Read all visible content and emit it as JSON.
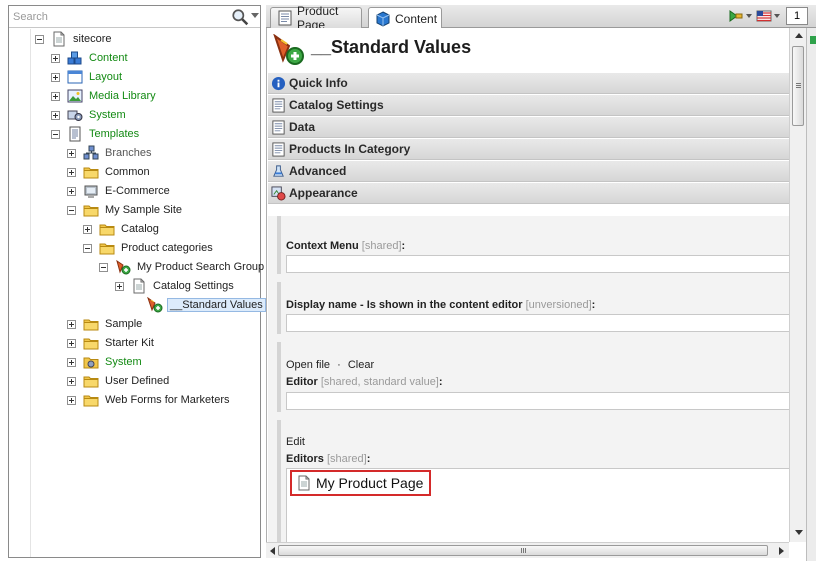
{
  "search": {
    "placeholder": "Search"
  },
  "tree": {
    "items": [
      {
        "label": "sitecore",
        "toggle": "minus",
        "color": "normal",
        "icon": "page-icon"
      },
      {
        "label": "Content",
        "toggle": "plus",
        "color": "green",
        "icon": "content-cubes-icon"
      },
      {
        "label": "Layout",
        "toggle": "plus",
        "color": "green",
        "icon": "layout-window-icon"
      },
      {
        "label": "Media Library",
        "toggle": "plus",
        "color": "green",
        "icon": "media-picture-icon"
      },
      {
        "label": "System",
        "toggle": "plus",
        "color": "green",
        "icon": "system-gear-icon"
      },
      {
        "label": "Templates",
        "toggle": "minus",
        "color": "green",
        "icon": "template-document-icon"
      },
      {
        "label": "Branches",
        "toggle": "plus",
        "color": "gray",
        "icon": "branches-icon"
      },
      {
        "label": "Common",
        "toggle": "plus",
        "color": "normal",
        "icon": "folder-icon"
      },
      {
        "label": "E-Commerce",
        "toggle": "plus",
        "color": "normal",
        "icon": "ecommerce-icon"
      },
      {
        "label": "My Sample Site",
        "toggle": "minus",
        "color": "normal",
        "icon": "folder-icon"
      },
      {
        "label": "Catalog",
        "toggle": "plus",
        "color": "normal",
        "icon": "folder-icon"
      },
      {
        "label": "Product categories",
        "toggle": "minus",
        "color": "normal",
        "icon": "folder-icon"
      },
      {
        "label": "My Product Search Group",
        "toggle": "minus",
        "color": "normal",
        "icon": "search-group-icon"
      },
      {
        "label": "Catalog Settings",
        "toggle": "plus",
        "color": "normal",
        "icon": "page-icon"
      },
      {
        "label": "__Standard Values",
        "toggle": "none",
        "color": "normal",
        "icon": "standard-values-icon",
        "selected": true
      },
      {
        "label": "Sample",
        "toggle": "plus",
        "color": "normal",
        "icon": "folder-icon"
      },
      {
        "label": "Starter Kit",
        "toggle": "plus",
        "color": "normal",
        "icon": "folder-icon"
      },
      {
        "label": "System",
        "toggle": "plus",
        "color": "green",
        "icon": "system-folder-icon"
      },
      {
        "label": "User Defined",
        "toggle": "plus",
        "color": "normal",
        "icon": "folder-icon"
      },
      {
        "label": "Web Forms for Marketers",
        "toggle": "plus",
        "color": "normal",
        "icon": "folder-icon"
      }
    ]
  },
  "tabs": {
    "product_page": "Product Page",
    "content": "Content"
  },
  "toolbar": {
    "language_number": "1"
  },
  "editor": {
    "title": "__Standard Values",
    "sections": {
      "quick_info": "Quick Info",
      "catalog_settings": "Catalog Settings",
      "data": "Data",
      "products_in_category": "Products In Category",
      "advanced": "Advanced",
      "appearance": "Appearance"
    },
    "fields": {
      "context_menu": {
        "label": "Context Menu",
        "note": "[shared]",
        "suffix": ":",
        "value": ""
      },
      "display_name": {
        "label": "Display name - Is shown in the content editor",
        "note": "[unversioned]",
        "suffix": ":",
        "value": ""
      },
      "editor": {
        "open_file": "Open file",
        "separator": "·",
        "clear": "Clear",
        "label": "Editor",
        "note": "[shared, standard value]",
        "suffix": ":",
        "value": ""
      },
      "editors": {
        "edit": "Edit",
        "label": "Editors",
        "note": "[shared]",
        "suffix": ":",
        "entry": "My Product Page"
      }
    }
  },
  "colors": {
    "tree_green": "#138a13",
    "highlight_border": "#d42a2a",
    "selection_bg": "#dcebfb",
    "section_bg": "#e0e0e0"
  }
}
